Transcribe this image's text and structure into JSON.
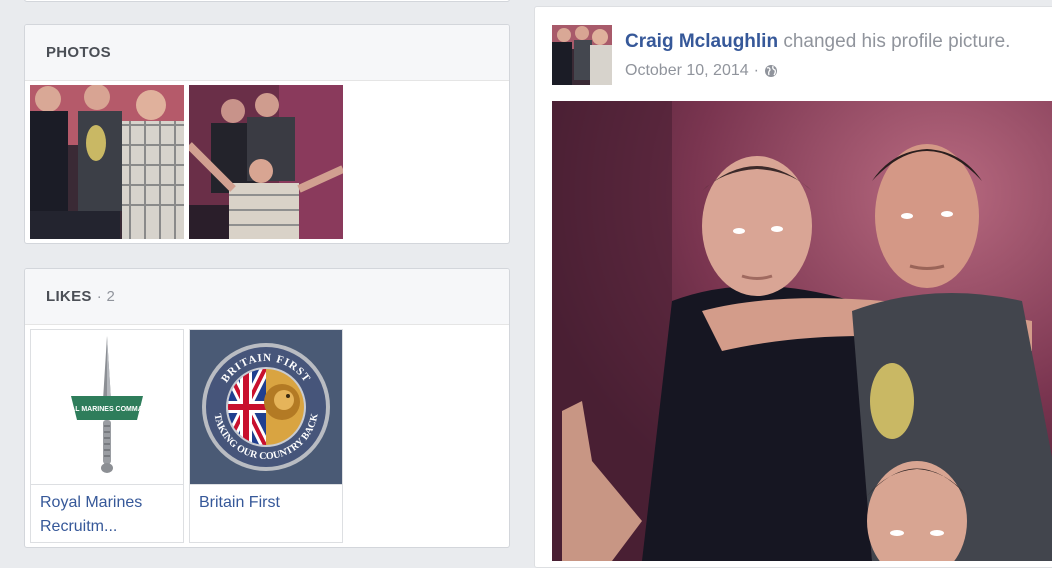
{
  "photos": {
    "title": "PHOTOS",
    "items": [
      {
        "alt": "group photo 1"
      },
      {
        "alt": "group photo 2"
      }
    ]
  },
  "likes": {
    "title": "LIKES",
    "count": "· 2",
    "items": [
      {
        "name": "Royal Marines Recruitm...",
        "logo_text": "ROYAL MARINES COMMANDO"
      },
      {
        "name": "Britain First",
        "logo_text_top": "BRITAIN FIRST",
        "logo_text_bottom": "TAKING OUR COUNTRY BACK"
      }
    ]
  },
  "post": {
    "author": "Craig Mclaughlin",
    "action": "changed his profile picture.",
    "date": "October 10, 2014",
    "separator": "·",
    "privacy_icon": "globe-icon"
  },
  "colors": {
    "link": "#365899",
    "meta": "#90949c",
    "page_bg": "#e9ebee"
  }
}
